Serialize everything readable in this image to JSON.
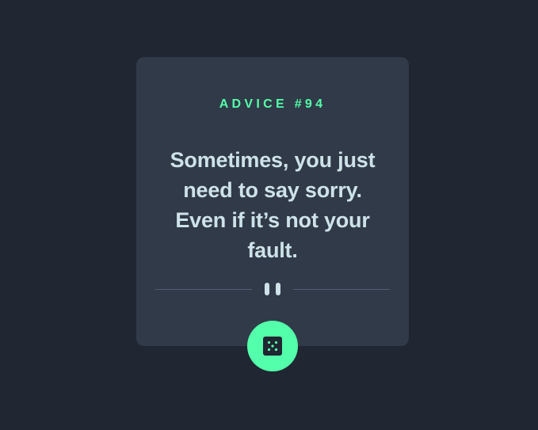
{
  "card": {
    "advice_label": "ADVICE #94",
    "advice_text": "Sometimes, you just need to say sorry. Even if it’s not your fault."
  },
  "dice_button": {
    "icon": "dice-icon",
    "accent_color": "#53ffaa"
  },
  "colors": {
    "background": "#202632",
    "card": "#313a48",
    "accent": "#53ffaa",
    "text": "#cee3e9"
  }
}
